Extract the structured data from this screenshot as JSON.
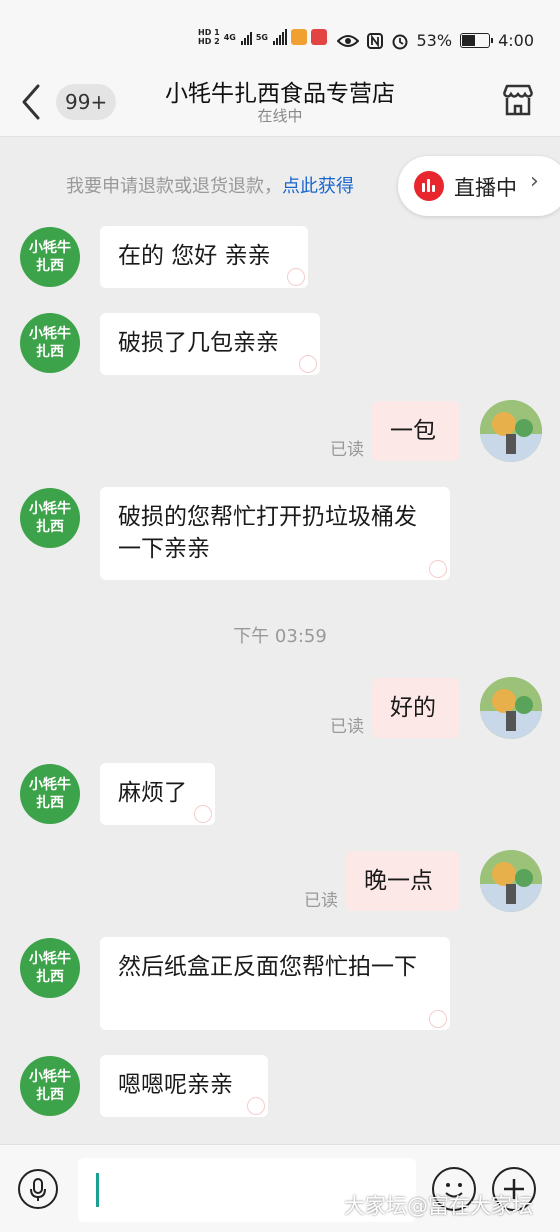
{
  "status_bar": {
    "hd1": "HD 1",
    "hd2": "HD 2",
    "net1": "4G",
    "net2": "5G",
    "battery_percent": "53%",
    "time": "4:00",
    "battery_level": 0.53
  },
  "header": {
    "unread_badge": "99+",
    "title": "小牦牛扎西食品专营店",
    "subtitle": "在线中"
  },
  "notice": {
    "text": "我要申请退款或退货退款，",
    "link": "点此获得"
  },
  "live": {
    "label": "直播中"
  },
  "shop_avatar": {
    "line1": "小牦牛",
    "line2": "扎西"
  },
  "messages": [
    {
      "from": "shop",
      "text": "在的 您好 亲亲"
    },
    {
      "from": "shop",
      "text": "破损了几包亲亲"
    },
    {
      "from": "me",
      "text": "一包",
      "status": "已读"
    },
    {
      "from": "shop",
      "text": "破损的您帮忙打开扔垃圾桶发一下亲亲"
    },
    {
      "from": "me",
      "text": "好的",
      "status": "已读"
    },
    {
      "from": "shop",
      "text": "麻烦了"
    },
    {
      "from": "me",
      "text": "晚一点",
      "status": "已读"
    },
    {
      "from": "shop",
      "text": "然后纸盒正反面您帮忙拍一下"
    },
    {
      "from": "shop",
      "text": "嗯嗯呢亲亲"
    }
  ],
  "timestamp": "下午 03:59",
  "watermark": "大家坛@富在大家坛",
  "colors": {
    "shop_avatar_bg": "#3da34a",
    "my_bubble": "#fde8e8",
    "link": "#1a66cc",
    "live_red": "#e8262d"
  }
}
